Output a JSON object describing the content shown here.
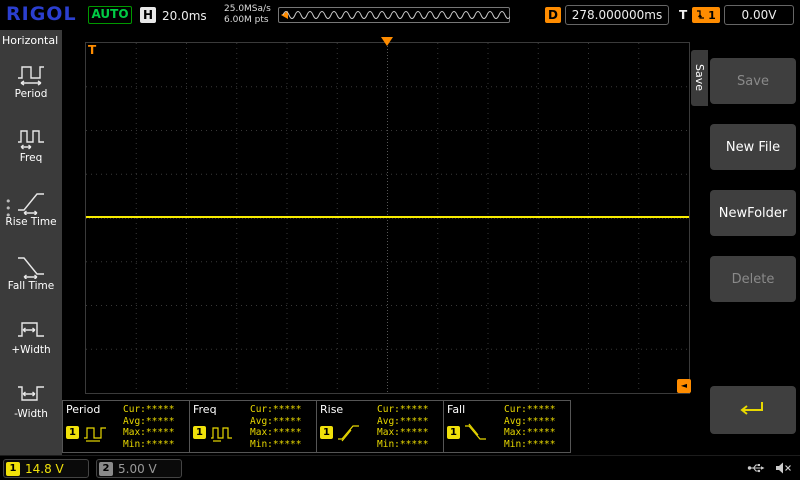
{
  "topbar": {
    "logo": "RIGOL",
    "mode": "AUTO",
    "h_label": "H",
    "timebase": "20.0ms",
    "sample_rate": "25.0MSa/s",
    "memory_depth": "6.00M pts",
    "d_label": "D",
    "delay": "278.000000ms",
    "t_label": "T",
    "trigger_channel": "1",
    "trigger_level": "0.00V"
  },
  "sidebar": {
    "title": "Horizontal",
    "items": [
      {
        "label": "Period"
      },
      {
        "label": "Freq"
      },
      {
        "label": "Rise Time"
      },
      {
        "label": "Fall Time"
      },
      {
        "label": "+Width"
      },
      {
        "label": "-Width"
      }
    ]
  },
  "right_menu": {
    "tab": "Save",
    "buttons": [
      {
        "label": "Save",
        "enabled": false
      },
      {
        "label": "New File",
        "enabled": true
      },
      {
        "label": "NewFolder",
        "enabled": true
      },
      {
        "label": "Delete",
        "enabled": false
      }
    ]
  },
  "measurements": [
    {
      "name": "Period",
      "channel": "1",
      "cur": "Cur:*****",
      "avg": "Avg:*****",
      "max": "Max:*****",
      "min": "Min:*****"
    },
    {
      "name": "Freq",
      "channel": "1",
      "cur": "Cur:*****",
      "avg": "Avg:*****",
      "max": "Max:*****",
      "min": "Min:*****"
    },
    {
      "name": "Rise",
      "channel": "1",
      "cur": "Cur:*****",
      "avg": "Avg:*****",
      "max": "Max:*****",
      "min": "Min:*****"
    },
    {
      "name": "Fall",
      "channel": "1",
      "cur": "Cur:*****",
      "avg": "Avg:*****",
      "max": "Max:*****",
      "min": "Min:*****"
    }
  ],
  "statusbar": {
    "ch1_number": "1",
    "ch1_scale": "14.8 V",
    "ch2_number": "2",
    "ch2_scale": "5.00 V"
  },
  "markers": {
    "grid_trigger_label": "T",
    "delay_marker_glyph": "◄"
  },
  "colors": {
    "channel1_yellow": "#f0e10a",
    "trigger_orange": "#ff8c00",
    "auto_green": "#00cc44",
    "logo_blue": "#2b3fd0"
  }
}
